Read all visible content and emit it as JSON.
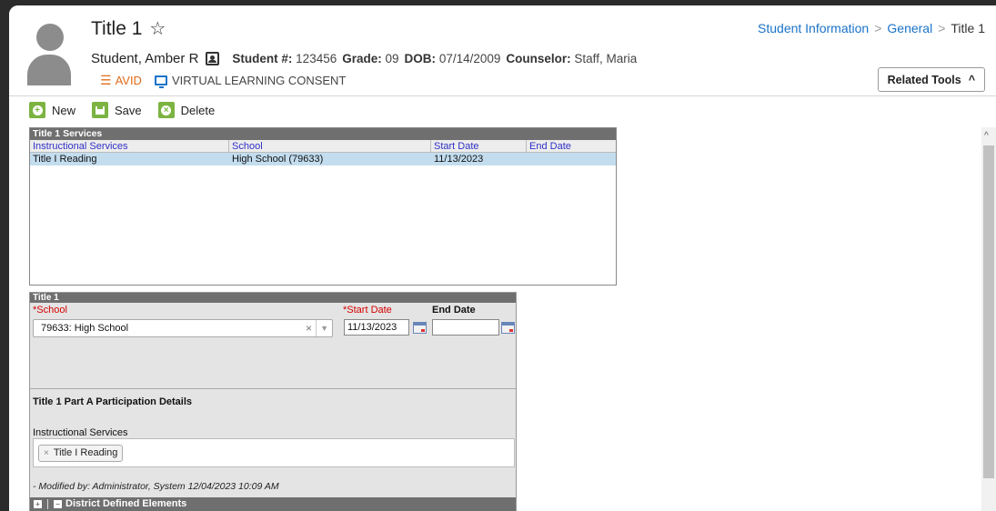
{
  "header": {
    "title": "Title 1",
    "breadcrumb": [
      "Student Information",
      "General",
      "Title 1"
    ],
    "student_name": "Student, Amber R",
    "student_num_label": "Student #:",
    "student_num": "123456",
    "grade_label": "Grade:",
    "grade": "09",
    "dob_label": "DOB:",
    "dob": "07/14/2009",
    "counselor_label": "Counselor:",
    "counselor": "Staff, Maria",
    "flags": {
      "avid": "AVID",
      "vlc": "VIRTUAL LEARNING CONSENT"
    },
    "related_tools": "Related Tools"
  },
  "toolbar": {
    "new_label": "New",
    "save_label": "Save",
    "delete_label": "Delete"
  },
  "services": {
    "title": "Title 1 Services",
    "columns": [
      "Instructional Services",
      "School",
      "Start Date",
      "End Date"
    ],
    "rows": [
      {
        "service": "Title I Reading",
        "school": "High School (79633)",
        "start": "11/13/2023",
        "end": ""
      }
    ]
  },
  "detail": {
    "title": "Title 1",
    "school_label": "*School",
    "school_value": "79633: High School",
    "start_label": "*Start Date",
    "start_value": "11/13/2023",
    "end_label": "End Date",
    "end_value": "",
    "section_heading": "Title 1 Part A Participation Details",
    "services_label": "Instructional Services",
    "services_tag": "Title I Reading",
    "modified": "- Modified by: Administrator, System 12/04/2023 10:09 AM",
    "district_elements": "District Defined Elements"
  },
  "icons": {
    "favorite": "star-outline-icon",
    "contact": "contact-card-icon",
    "avid": "list-check-icon",
    "vlc": "monitor-icon",
    "chevron": "chevron-up-icon"
  },
  "colors": {
    "link": "#1a73c7",
    "avid": "#e06c1a",
    "toolbar_green": "#7cb342",
    "selected_row": "#c3ddef",
    "required": "#d40000"
  }
}
